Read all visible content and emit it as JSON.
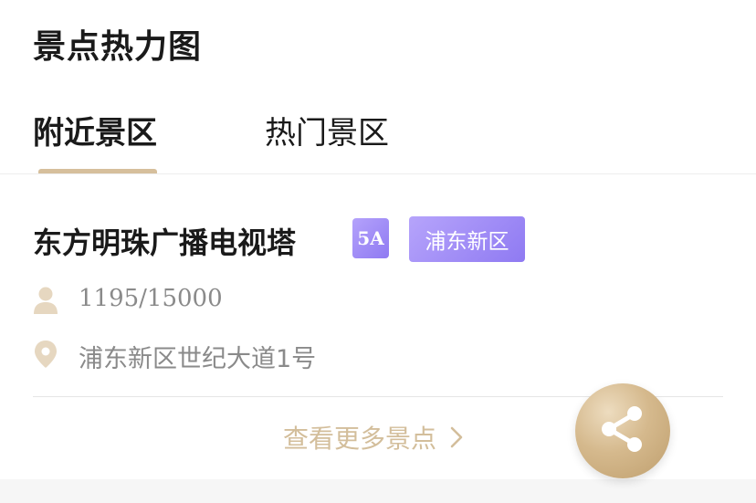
{
  "header": {
    "title": "景点热力图"
  },
  "tabs": [
    {
      "label": "附近景区",
      "active": true
    },
    {
      "label": "热门景区",
      "active": false
    }
  ],
  "spot": {
    "name": "东方明珠广播电视塔",
    "rating_badge": "5A",
    "district_badge": "浦东新区",
    "visitors": "1195/15000",
    "address": "浦东新区世纪大道1号"
  },
  "more_link": {
    "label": "查看更多景点"
  },
  "icons": {
    "visitors": "person-icon",
    "address": "location-pin-icon",
    "more": "chevron-right-icon",
    "share": "share-icon"
  },
  "colors": {
    "accent_gold": "#d6bf9c",
    "badge_purple": "#9d89f6",
    "muted_text": "#8a8a8a"
  }
}
